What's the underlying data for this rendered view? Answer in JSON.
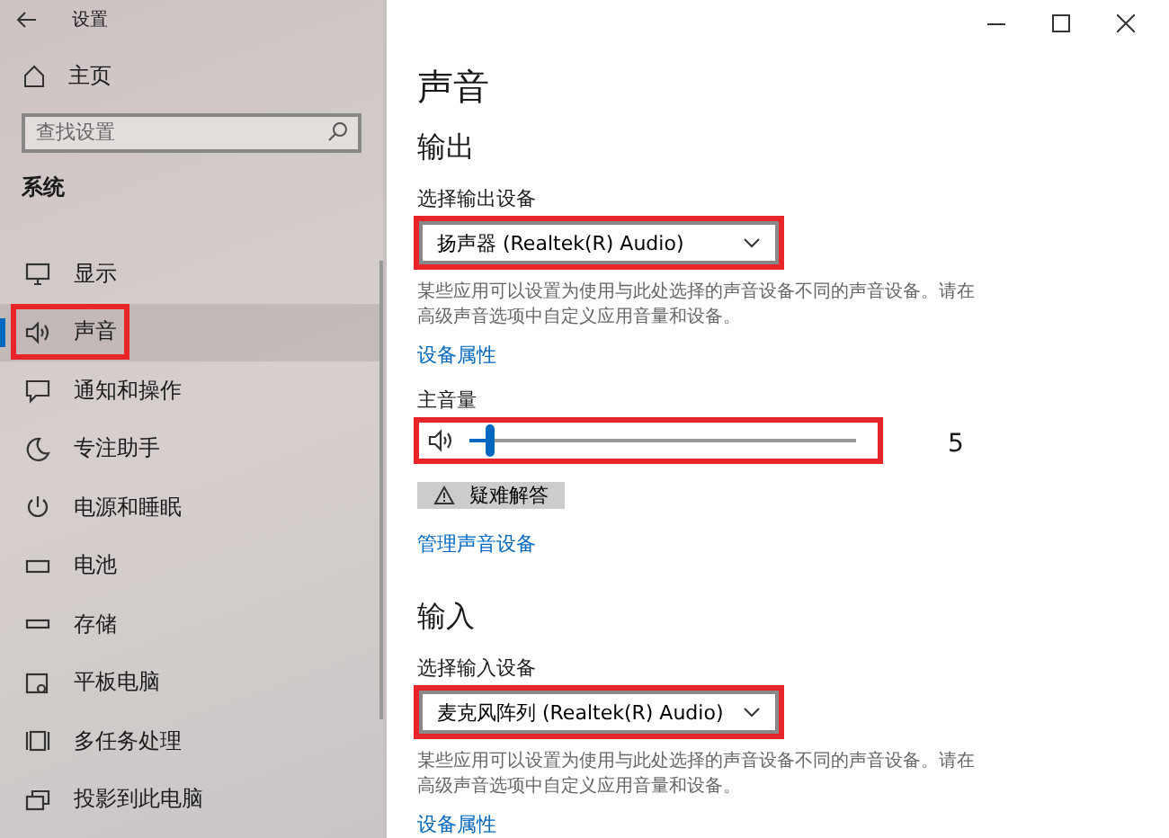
{
  "window": {
    "title": "设置"
  },
  "sidebar": {
    "home": "主页",
    "search": {
      "placeholder": "查找设置"
    },
    "section": "系统",
    "items": [
      {
        "label": "显示",
        "selected": false,
        "highlighted": false
      },
      {
        "label": "声音",
        "selected": true,
        "highlighted": true
      },
      {
        "label": "通知和操作",
        "selected": false,
        "highlighted": false
      },
      {
        "label": "专注助手",
        "selected": false,
        "highlighted": false
      },
      {
        "label": "电源和睡眠",
        "selected": false,
        "highlighted": false
      },
      {
        "label": "电池",
        "selected": false,
        "highlighted": false
      },
      {
        "label": "存储",
        "selected": false,
        "highlighted": false
      },
      {
        "label": "平板电脑",
        "selected": false,
        "highlighted": false
      },
      {
        "label": "多任务处理",
        "selected": false,
        "highlighted": false
      },
      {
        "label": "投影到此电脑",
        "selected": false,
        "highlighted": false
      }
    ]
  },
  "page": {
    "title": "声音",
    "output": {
      "heading": "输出",
      "device_label": "选择输出设备",
      "device": "扬声器 (Realtek(R) Audio)",
      "device_highlighted": true,
      "description": "某些应用可以设置为使用与此处选择的声音设备不同的声音设备。请在高级声音选项中自定义应用音量和设备。",
      "properties_link": "设备属性",
      "volume_label": "主音量",
      "volume": {
        "level": 0.05,
        "highlighted": true,
        "reading": "5"
      },
      "troubleshoot": "疑难解答",
      "manage_link": "管理声音设备"
    },
    "input": {
      "heading": "输入",
      "device_label": "选择输入设备",
      "device": "麦克风阵列 (Realtek(R) Audio)",
      "device_highlighted": true,
      "description": "某些应用可以设置为使用与此处选择的声音设备不同的声音设备。请在高级声音选项中自定义应用音量和设备。",
      "properties_link": "设备属性"
    }
  }
}
